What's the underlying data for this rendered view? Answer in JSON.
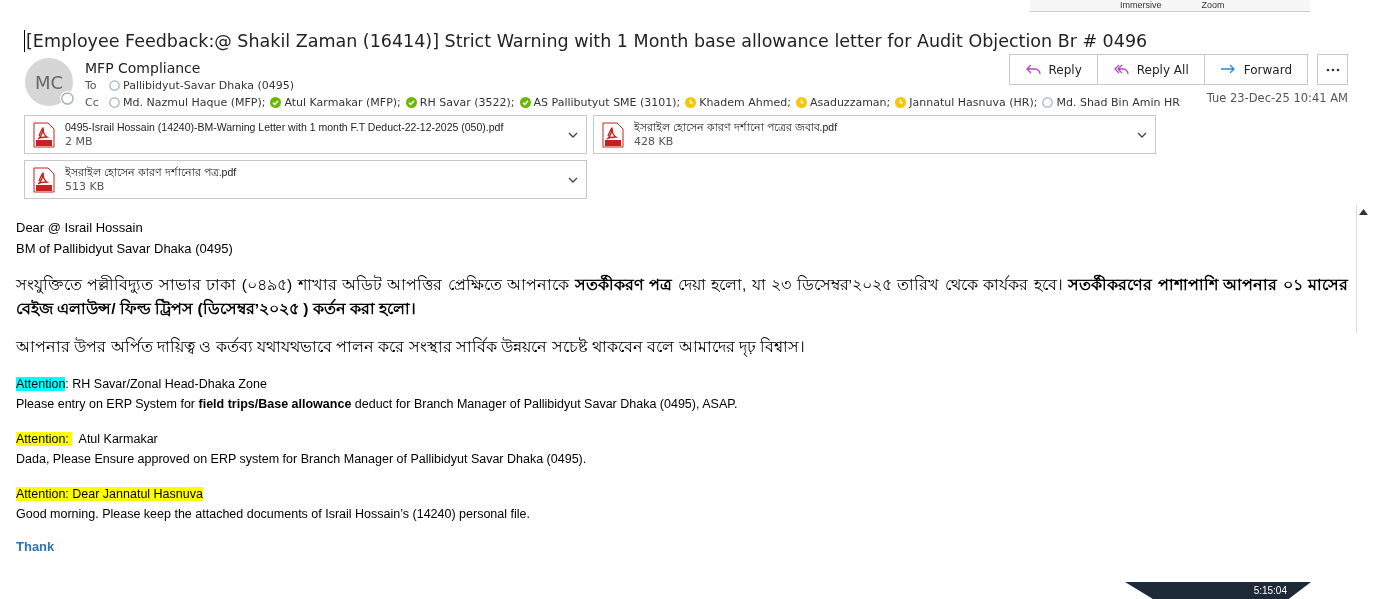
{
  "toolbar_fragment": {
    "items": [
      "Immersive",
      "Zoom"
    ]
  },
  "subject": "[Employee Feedback:@ Shakil Zaman (16414)] Strict Warning with 1 Month base allowance letter for Audit Objection Br # 0496",
  "sender": {
    "initials": "MC",
    "name": "MFP Compliance"
  },
  "to": {
    "label": "To",
    "recipients": [
      {
        "name": "Pallibidyut-Savar Dhaka (0495)",
        "kind": "offline"
      }
    ]
  },
  "cc": {
    "label": "Cc",
    "recipients": [
      {
        "name": "Md. Nazmul Haque (MFP);",
        "kind": "offline"
      },
      {
        "name": "Atul  Karmakar (MFP);",
        "kind": "available"
      },
      {
        "name": "RH Savar (3522);",
        "kind": "available"
      },
      {
        "name": "AS Pallibutyut SME (3101);",
        "kind": "available"
      },
      {
        "name": "Khadem Ahmed;",
        "kind": "away"
      },
      {
        "name": "Asaduzzaman;",
        "kind": "away"
      },
      {
        "name": "Jannatul Hasnuva (HR);",
        "kind": "away"
      },
      {
        "name": "Md. Shad Bin Amin HR",
        "kind": "offline"
      }
    ]
  },
  "actions": [
    {
      "kind": "reply",
      "label": "Reply"
    },
    {
      "kind": "reply_all",
      "label": "Reply All"
    },
    {
      "kind": "forward",
      "label": "Forward"
    },
    {
      "kind": "more"
    }
  ],
  "date": "Tue 23-Dec-25 10:41 AM",
  "attachments": [
    {
      "name": "0495-Israil Hossain (14240)-BM-Warning Letter with 1 month F.T Deduct-22-12-2025 (050).pdf",
      "size": "2 MB"
    },
    {
      "name": "ইসরাইল হোসেন কারণ দর্শানো পত্রের জবাব.pdf",
      "size": "428 KB"
    },
    {
      "name": "ইসরাইল হোসেন কারণ দর্শানোর পত্র.pdf",
      "size": "513 KB"
    }
  ],
  "body": {
    "greeting": [
      "Dear @ Israil Hossain",
      "BM of Pallibidyut Savar Dhaka (0495)"
    ],
    "paragraphs": [
      "সংযুক্তিতে পল্লীবিদ্যুত সাভার ঢাকা (০৪৯৫) শাখার অডিট আপত্তির প্রেক্ষিতে আপনাকে **সতর্কীকরণ পত্র** দেয়া হলো, যা ২৩ ডিসেম্বর’২০২৫ তারিখ থেকে কার্যকর হবে। **সতর্কীকরণের পাশাপাশি আপনার ০১ মাসের বেইজ এলাউন্স/ ফিল্ড ট্রিপস (ডিসেম্বর’২০২৫ ) কর্তন করা হলো।**",
      "আপনার উপর অর্পিত দায়িত্ব ও কর্তব্য যথাযথভাবে পালন করে সংস্থার সার্বিক উন্নয়নে সচেষ্ট থাকবেন বলে আমাদের দৃঢ় বিশ্বাস।"
    ],
    "attentions": [
      {
        "highlight": "Attention",
        "color": "#00ffff",
        "rest": ": RH Savar/Zonal Head-Dhaka Zone",
        "message": "Please entry on ERP System for **field trips/Base allowance** deduct for Branch Manager of Pallibidyut Savar Dhaka (0495), ASAP."
      },
      {
        "highlight": "Attention: ",
        "color": "#ffff00",
        "rest": "  Atul Karmakar",
        "message": "Dada, Please Ensure approved on ERP system for Branch Manager of Pallibidyut Savar Dhaka (0495)."
      },
      {
        "highlight": "Attention: Dear Jannatul Hasnuva",
        "color": "#ffff00",
        "message": "Good morning. Please keep the attached documents of Israil Hossain’s (14240) personal file."
      }
    ],
    "closing": "Thank"
  },
  "taskbar": {
    "clock": "5:15:04"
  }
}
